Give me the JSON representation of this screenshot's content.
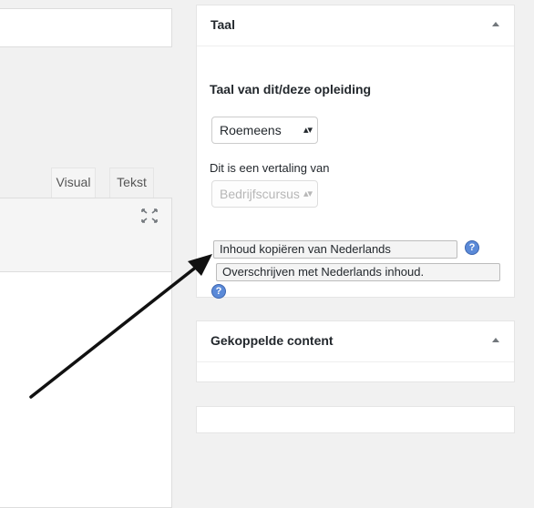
{
  "editor": {
    "tabs": [
      {
        "label": "Visual"
      },
      {
        "label": "Tekst"
      }
    ]
  },
  "language_box": {
    "title": "Taal",
    "language_label": "Taal van dit/deze opleiding",
    "language_value": "Roemeens",
    "translation_label": "Dit is een vertaling van",
    "translation_value": "Bedrijfscursus",
    "copy_button": "Inhoud kopiëren van Nederlands",
    "overwrite_button": "Overschrijven met Nederlands inhoud."
  },
  "linked_box": {
    "title": "Gekoppelde content"
  },
  "icons": [
    "fullscreen-icon",
    "help-icon",
    "collapse-arrow-icon",
    "select-arrows-icon"
  ],
  "colors": {
    "help_icon": "#5b8ad8",
    "arrow": "#111111"
  }
}
